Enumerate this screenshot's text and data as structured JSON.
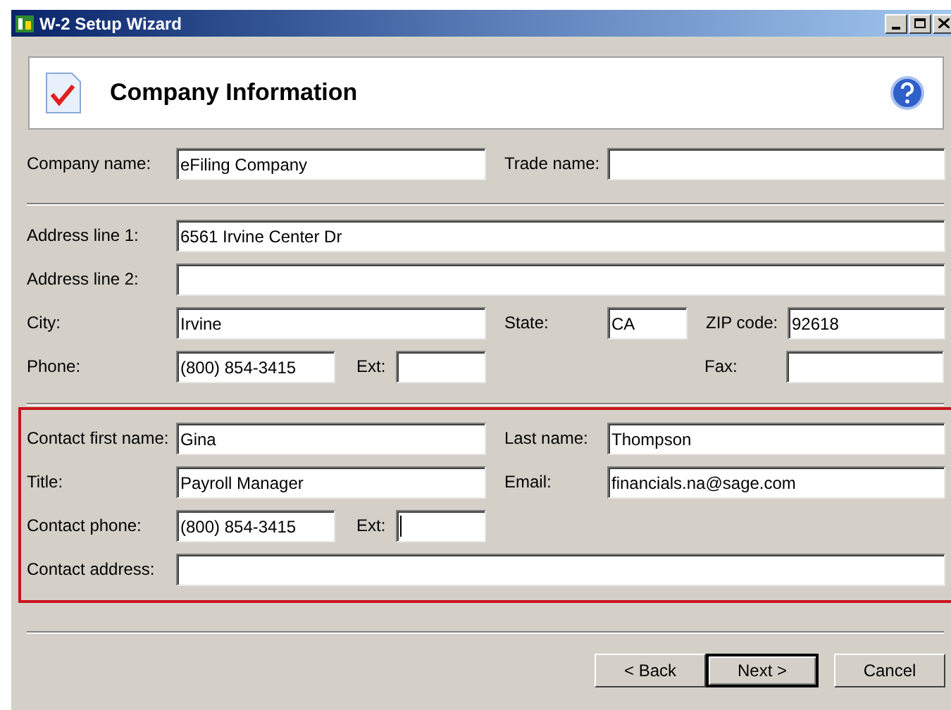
{
  "window": {
    "title": "W-2 Setup Wizard"
  },
  "header": {
    "title": "Company Information"
  },
  "sections": [
    {
      "highlighted": false,
      "rows": [
        {
          "kind": "pair",
          "fields": [
            {
              "label": "Company name:",
              "value": "eFiling Company"
            },
            {
              "label": "Trade name:"
            }
          ]
        }
      ]
    },
    {
      "highlighted": false,
      "rows": [
        {
          "kind": "single",
          "fields": [
            {
              "label": "Address line 1:",
              "value": "6561 Irvine Center Dr"
            }
          ]
        },
        {
          "kind": "single",
          "fields": [
            {
              "label": "Address line 2:"
            }
          ]
        },
        {
          "kind": "city",
          "fields": [
            {
              "label": "City:",
              "value": "Irvine"
            },
            {
              "label": "State:",
              "value": "CA"
            },
            {
              "label": "ZIP code:",
              "value": "92618"
            }
          ]
        },
        {
          "kind": "phone_fax",
          "fields": [
            {
              "label": "Phone:",
              "value": "(800) 854-3415"
            },
            {
              "label": "Ext:"
            },
            {
              "label": "Fax:"
            }
          ]
        }
      ]
    },
    {
      "highlighted": true,
      "rows": [
        {
          "kind": "pair",
          "fields": [
            {
              "label": "Contact first name:",
              "value": "Gina"
            },
            {
              "label": "Last name:",
              "value": "Thompson"
            }
          ]
        },
        {
          "kind": "pair",
          "fields": [
            {
              "label": "Title:",
              "value": "Payroll Manager"
            },
            {
              "label": "Email:",
              "value": "financials.na@sage.com"
            }
          ]
        },
        {
          "kind": "phone",
          "fields": [
            {
              "label": "Contact phone:",
              "value": "(800) 854-3415"
            },
            {
              "label": "Ext:",
              "focused": true
            }
          ]
        },
        {
          "kind": "single",
          "fields": [
            {
              "label": "Contact address:"
            }
          ]
        }
      ]
    }
  ],
  "buttons": [
    {
      "label": "< Back",
      "default": false
    },
    {
      "label": "Next >",
      "default": true
    },
    {
      "label": "Cancel",
      "default": false
    }
  ]
}
